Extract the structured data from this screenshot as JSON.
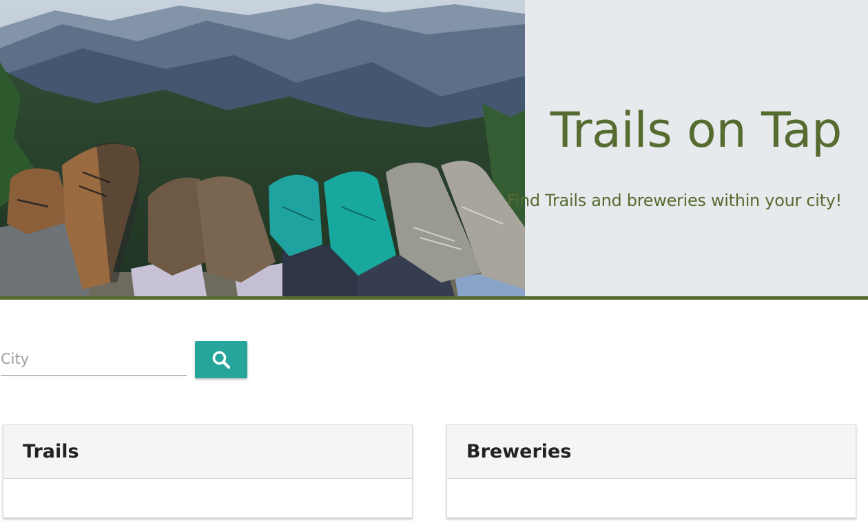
{
  "hero": {
    "title": "Trails on Tap",
    "tagline": "Find Trails and breweries within your city!",
    "image_alt": "Hikers' boots resting on a ledge overlooking forested mountains"
  },
  "search": {
    "placeholder": "City",
    "value": "",
    "button_icon": "search-icon"
  },
  "cards": {
    "trails": {
      "title": "Trails"
    },
    "breweries": {
      "title": "Breweries"
    }
  },
  "colors": {
    "accent_green": "#556b2f",
    "button_teal": "#26a69a",
    "hero_bg": "#e7eaed"
  }
}
